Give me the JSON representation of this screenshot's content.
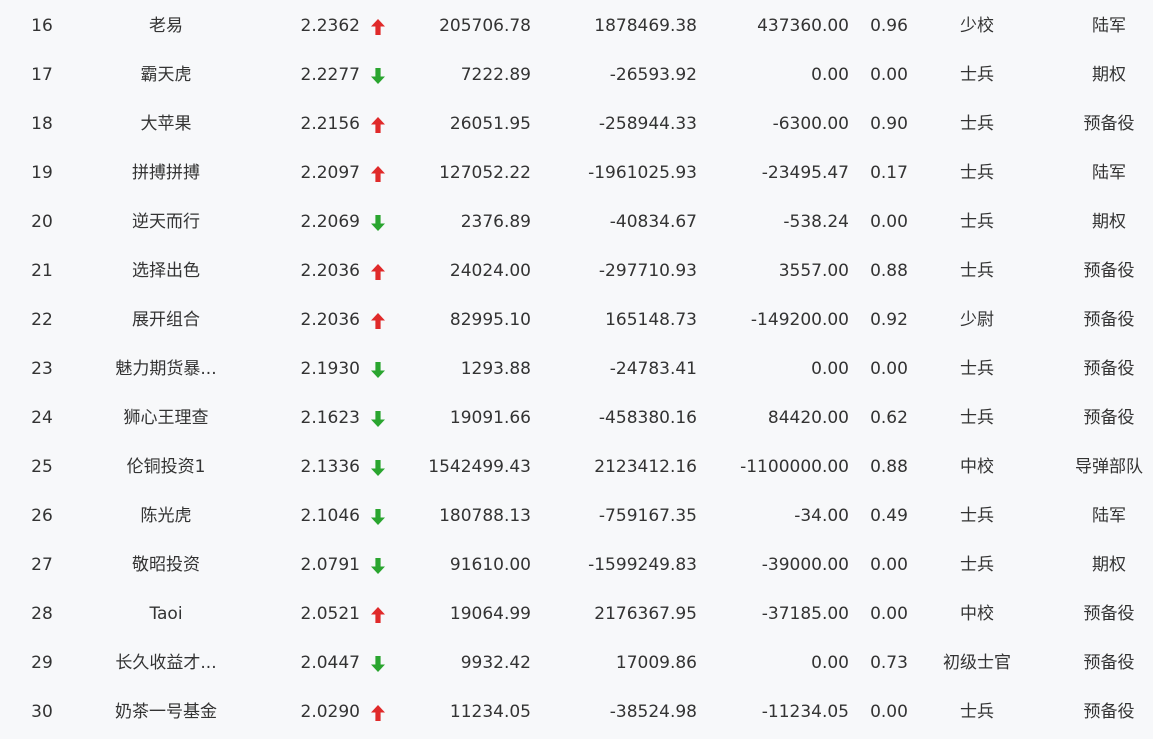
{
  "colors": {
    "up": "#e02a2a",
    "down": "#2aa52f",
    "text": "#333333",
    "background": "#f7f8fa"
  },
  "rows": [
    {
      "rank": "16",
      "name": "老易",
      "nav": "2.2362",
      "trend": "up",
      "v1": "205706.78",
      "v2": "1878469.38",
      "v3": "437360.00",
      "ratio": "0.96",
      "level": "少校",
      "group": "陆军"
    },
    {
      "rank": "17",
      "name": "霸天虎",
      "nav": "2.2277",
      "trend": "down",
      "v1": "7222.89",
      "v2": "-26593.92",
      "v3": "0.00",
      "ratio": "0.00",
      "level": "士兵",
      "group": "期权"
    },
    {
      "rank": "18",
      "name": "大苹果",
      "nav": "2.2156",
      "trend": "up",
      "v1": "26051.95",
      "v2": "-258944.33",
      "v3": "-6300.00",
      "ratio": "0.90",
      "level": "士兵",
      "group": "预备役"
    },
    {
      "rank": "19",
      "name": "拼搏拼搏",
      "nav": "2.2097",
      "trend": "up",
      "v1": "127052.22",
      "v2": "-1961025.93",
      "v3": "-23495.47",
      "ratio": "0.17",
      "level": "士兵",
      "group": "陆军"
    },
    {
      "rank": "20",
      "name": "逆天而行",
      "nav": "2.2069",
      "trend": "down",
      "v1": "2376.89",
      "v2": "-40834.67",
      "v3": "-538.24",
      "ratio": "0.00",
      "level": "士兵",
      "group": "期权"
    },
    {
      "rank": "21",
      "name": "选择出色",
      "nav": "2.2036",
      "trend": "up",
      "v1": "24024.00",
      "v2": "-297710.93",
      "v3": "3557.00",
      "ratio": "0.88",
      "level": "士兵",
      "group": "预备役"
    },
    {
      "rank": "22",
      "name": "展开组合",
      "nav": "2.2036",
      "trend": "up",
      "v1": "82995.10",
      "v2": "165148.73",
      "v3": "-149200.00",
      "ratio": "0.92",
      "level": "少尉",
      "group": "预备役"
    },
    {
      "rank": "23",
      "name": "魅力期货暴...",
      "nav": "2.1930",
      "trend": "down",
      "v1": "1293.88",
      "v2": "-24783.41",
      "v3": "0.00",
      "ratio": "0.00",
      "level": "士兵",
      "group": "预备役"
    },
    {
      "rank": "24",
      "name": "狮心王理查",
      "nav": "2.1623",
      "trend": "down",
      "v1": "19091.66",
      "v2": "-458380.16",
      "v3": "84420.00",
      "ratio": "0.62",
      "level": "士兵",
      "group": "预备役"
    },
    {
      "rank": "25",
      "name": "伦铜投资1",
      "nav": "2.1336",
      "trend": "down",
      "v1": "1542499.43",
      "v2": "2123412.16",
      "v3": "-1100000.00",
      "ratio": "0.88",
      "level": "中校",
      "group": "导弹部队"
    },
    {
      "rank": "26",
      "name": "陈光虎",
      "nav": "2.1046",
      "trend": "down",
      "v1": "180788.13",
      "v2": "-759167.35",
      "v3": "-34.00",
      "ratio": "0.49",
      "level": "士兵",
      "group": "陆军"
    },
    {
      "rank": "27",
      "name": "敬昭投资",
      "nav": "2.0791",
      "trend": "down",
      "v1": "91610.00",
      "v2": "-1599249.83",
      "v3": "-39000.00",
      "ratio": "0.00",
      "level": "士兵",
      "group": "期权"
    },
    {
      "rank": "28",
      "name": "Taoi",
      "nav": "2.0521",
      "trend": "up",
      "v1": "19064.99",
      "v2": "2176367.95",
      "v3": "-37185.00",
      "ratio": "0.00",
      "level": "中校",
      "group": "预备役"
    },
    {
      "rank": "29",
      "name": "长久收益才...",
      "nav": "2.0447",
      "trend": "down",
      "v1": "9932.42",
      "v2": "17009.86",
      "v3": "0.00",
      "ratio": "0.73",
      "level": "初级士官",
      "group": "预备役"
    },
    {
      "rank": "30",
      "name": "奶茶一号基金",
      "nav": "2.0290",
      "trend": "up",
      "v1": "11234.05",
      "v2": "-38524.98",
      "v3": "-11234.05",
      "ratio": "0.00",
      "level": "士兵",
      "group": "预备役"
    }
  ]
}
